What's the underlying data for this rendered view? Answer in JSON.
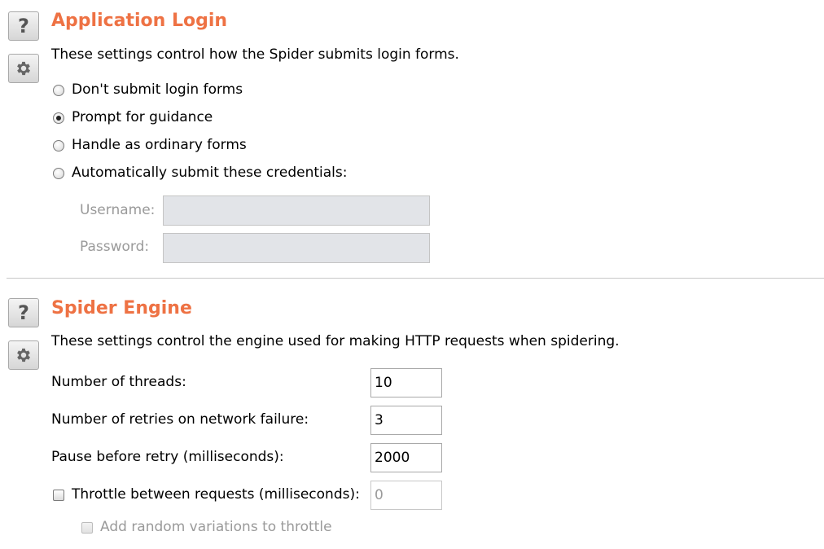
{
  "login": {
    "title": "Application Login",
    "description": "These settings control how the Spider submits login forms.",
    "help_icon": "question-mark-icon",
    "settings_icon": "gear-icon",
    "options": [
      {
        "label": "Don't submit login forms",
        "selected": false
      },
      {
        "label": "Prompt for guidance",
        "selected": true
      },
      {
        "label": "Handle as ordinary forms",
        "selected": false
      },
      {
        "label": "Automatically submit these credentials:",
        "selected": false
      }
    ],
    "username": {
      "label": "Username:",
      "value": ""
    },
    "password": {
      "label": "Password:",
      "value": ""
    }
  },
  "engine": {
    "title": "Spider Engine",
    "description": "These settings control the engine used for making HTTP requests when spidering.",
    "help_icon": "question-mark-icon",
    "settings_icon": "gear-icon",
    "threads": {
      "label": "Number of threads:",
      "value": "10"
    },
    "retries": {
      "label": "Number of retries on network failure:",
      "value": "3"
    },
    "pause": {
      "label": "Pause before retry (milliseconds):",
      "value": "2000"
    },
    "throttle": {
      "label": "Throttle between requests (milliseconds):",
      "value": "0",
      "checked": false
    },
    "random": {
      "label": "Add random variations to throttle",
      "checked": false,
      "disabled": true
    }
  },
  "colors": {
    "title": "#ee7244"
  }
}
